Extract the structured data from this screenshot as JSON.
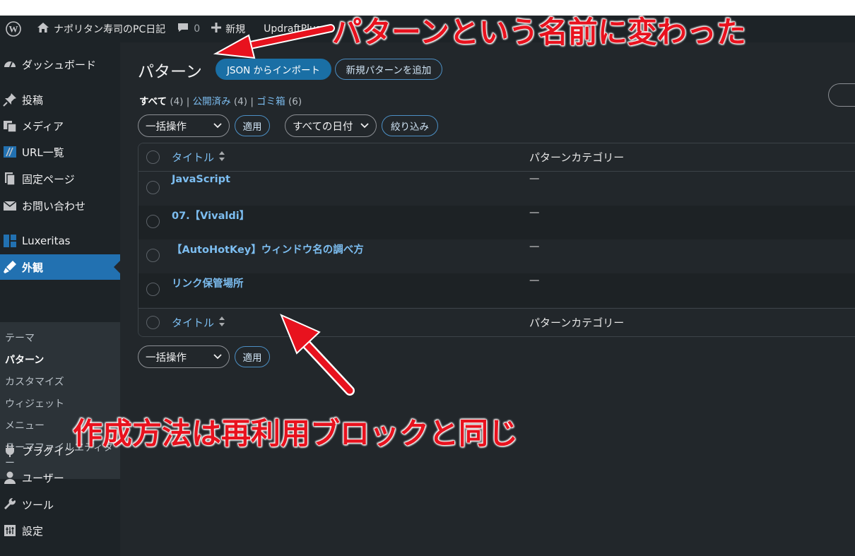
{
  "admin_bar": {
    "site_name": "ナポリタン寿司のPC日記",
    "comments_count": "0",
    "new_label": "新規",
    "updraft_label": "UpdraftPlus"
  },
  "sidebar": {
    "items": [
      {
        "label": "ダッシュボード",
        "icon": "dashboard-icon"
      },
      {
        "label": "投稿",
        "icon": "pin-icon"
      },
      {
        "label": "メディア",
        "icon": "media-icon"
      },
      {
        "label": "URL一覧",
        "icon": "url-list-icon"
      },
      {
        "label": "固定ページ",
        "icon": "page-icon"
      },
      {
        "label": "お問い合わせ",
        "icon": "mail-icon"
      },
      {
        "label": "Luxeritas",
        "icon": "luxeritas-icon"
      },
      {
        "label": "外観",
        "icon": "brush-icon"
      },
      {
        "label": "プラグイン",
        "icon": "plugin-icon"
      },
      {
        "label": "ユーザー",
        "icon": "user-icon"
      },
      {
        "label": "ツール",
        "icon": "wrench-icon"
      },
      {
        "label": "設定",
        "icon": "settings-icon"
      }
    ],
    "submenu": [
      "テーマ",
      "パターン",
      "カスタマイズ",
      "ウィジェット",
      "メニュー",
      "テーマファイルエディター"
    ]
  },
  "main": {
    "title": "パターン",
    "import_button": "JSON からインポート",
    "add_button": "新規パターンを追加",
    "filters": {
      "all": "すべて",
      "all_count": "(4)",
      "published": "公開済み",
      "published_count": "(4)",
      "trash": "ゴミ箱",
      "trash_count": "(6)",
      "sep": "|"
    },
    "bulk_action": "一括操作",
    "apply": "適用",
    "date_filter": "すべての日付",
    "filter_button": "絞り込み",
    "columns": {
      "title": "タイトル",
      "category": "パターンカテゴリー"
    },
    "rows": [
      {
        "title": "JavaScript",
        "category": "—"
      },
      {
        "title": "07.【Vivaldi】",
        "category": "—"
      },
      {
        "title": "【AutoHotKey】ウィンドウ名の調べ方",
        "category": "—"
      },
      {
        "title": "リンク保管場所",
        "category": "—"
      }
    ]
  },
  "annotations": {
    "top": "パターンという名前に変わった",
    "bottom": "作成方法は再利用ブロックと同じ",
    "color": "#e8121e"
  }
}
